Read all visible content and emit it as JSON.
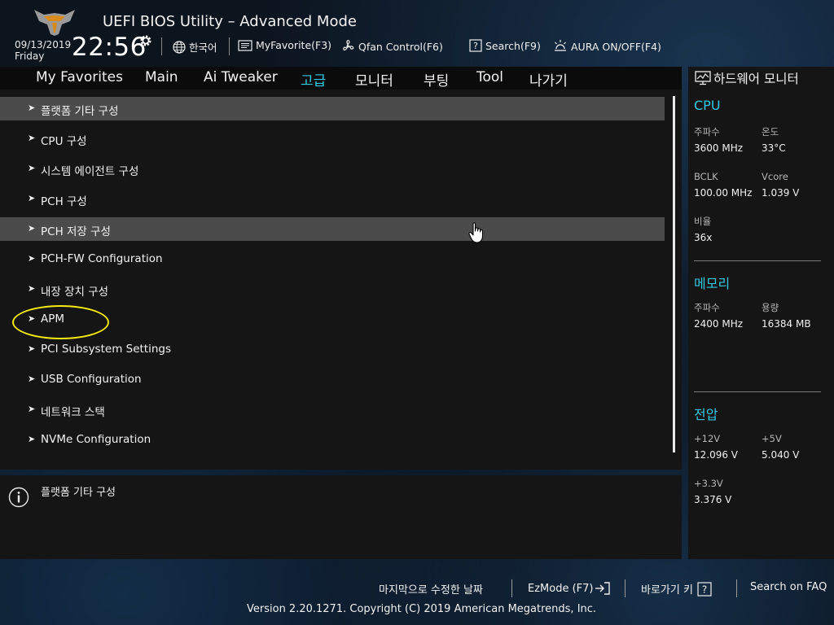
{
  "header": {
    "title": "UEFI BIOS Utility – Advanced Mode",
    "date": "09/13/2019",
    "day": "Friday",
    "time": "22:56",
    "language": "한국어",
    "myfavorite": "MyFavorite(F3)",
    "qfan": "Qfan Control(F6)",
    "search": "Search(F9)",
    "aura": "AURA ON/OFF(F4)"
  },
  "tabs": [
    "My Favorites",
    "Main",
    "Ai Tweaker",
    "고급",
    "모니터",
    "부팅",
    "Tool",
    "나가기"
  ],
  "active_tab": "고급",
  "menu": [
    "플랫폼 기타 구성",
    "CPU 구성",
    "시스템 에이전트 구성",
    "PCH 구성",
    "PCH 저장 구성",
    "PCH-FW Configuration",
    "내장 장치 구성",
    "APM",
    "PCI Subsystem Settings",
    "USB Configuration",
    "네트워크 스택",
    "NVMe Configuration"
  ],
  "info_text": "플랫폼 기타 구성",
  "hw": {
    "title": "하드웨어 모니터",
    "cpu_title": "CPU",
    "freq_label": "주파수",
    "freq_value": "3600 MHz",
    "temp_label": "온도",
    "temp_value": "33°C",
    "bclk_label": "BCLK",
    "bclk_value": "100.00 MHz",
    "vcore_label": "Vcore",
    "vcore_value": "1.039 V",
    "ratio_label": "비율",
    "ratio_value": "36x",
    "mem_title": "메모리",
    "mem_freq_label": "주파수",
    "mem_freq_value": "2400 MHz",
    "mem_cap_label": "용량",
    "mem_cap_value": "16384 MB",
    "volt_title": "전압",
    "v12_label": "+12V",
    "v12_value": "12.096 V",
    "v5_label": "+5V",
    "v5_value": "5.040 V",
    "v33_label": "+3.3V",
    "v33_value": "3.376 V"
  },
  "footer": {
    "last_modified": "마지막으로 수정한 날짜",
    "ezmode": "EzMode (F7)",
    "hotkeys": "바로가기 키",
    "faq": "Search on FAQ",
    "version": "Version 2.20.1271. Copyright (C) 2019 American Megatrends, Inc."
  },
  "colors": {
    "accent": "#31c8e0",
    "highlight_row": "#4b4b4b",
    "annotation": "#f5ea12"
  }
}
